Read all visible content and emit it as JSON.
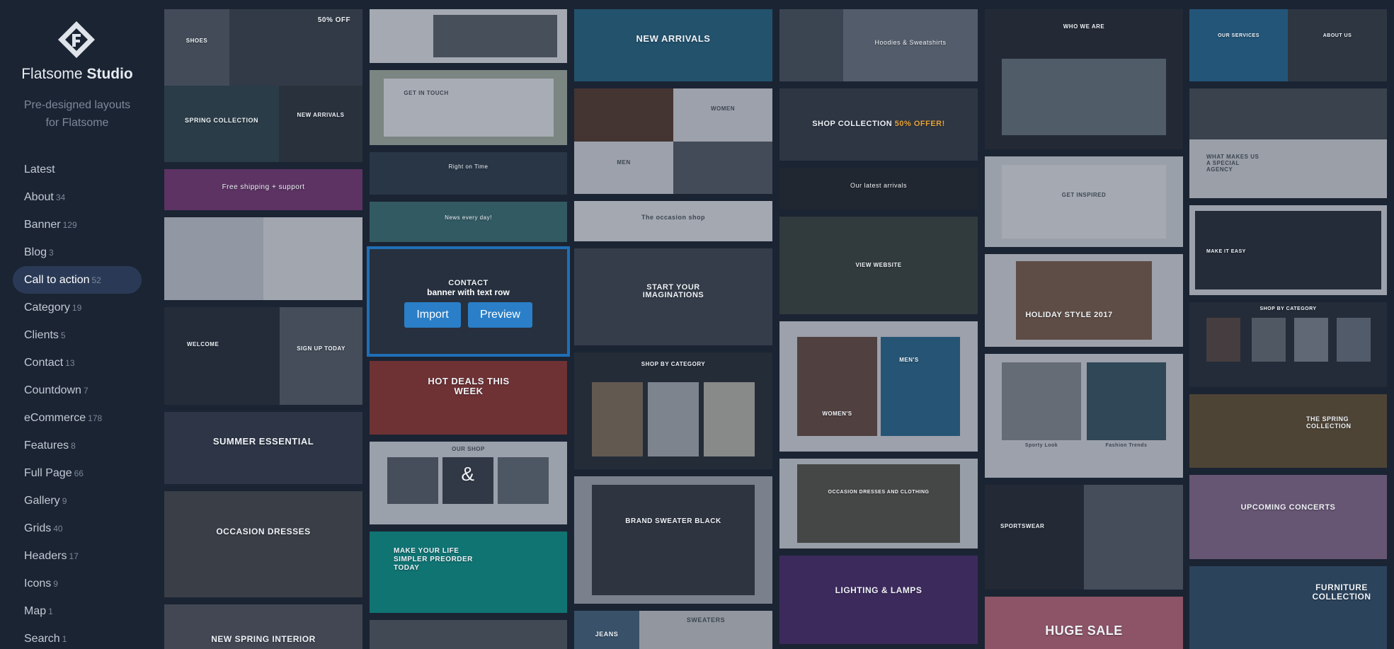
{
  "brand": {
    "name_regular": "Flatsome",
    "name_bold": "Studio",
    "tagline_line1": "Pre-designed layouts",
    "tagline_line2": "for Flatsome"
  },
  "nav": [
    {
      "label": "Latest",
      "count": ""
    },
    {
      "label": "About",
      "count": "34"
    },
    {
      "label": "Banner",
      "count": "129"
    },
    {
      "label": "Blog",
      "count": "3"
    },
    {
      "label": "Call to action",
      "count": "52"
    },
    {
      "label": "Category",
      "count": "19"
    },
    {
      "label": "Clients",
      "count": "5"
    },
    {
      "label": "Contact",
      "count": "13"
    },
    {
      "label": "Countdown",
      "count": "7"
    },
    {
      "label": "eCommerce",
      "count": "178"
    },
    {
      "label": "Features",
      "count": "8"
    },
    {
      "label": "Full Page",
      "count": "66"
    },
    {
      "label": "Gallery",
      "count": "9"
    },
    {
      "label": "Grids",
      "count": "40"
    },
    {
      "label": "Headers",
      "count": "17"
    },
    {
      "label": "Icons",
      "count": "9"
    },
    {
      "label": "Map",
      "count": "1"
    },
    {
      "label": "Search",
      "count": "1"
    }
  ],
  "selected": {
    "title": "CONTACT",
    "hover_label": "banner with text row",
    "import_label": "Import",
    "preview_label": "Preview"
  },
  "colors": {
    "sidebar_bg": "#1b2433",
    "active_item": "#2a3a56",
    "accent": "#2a7fc8",
    "selected_outline": "#1f6fb6"
  },
  "tiles": {
    "c1_shoes": "SHOES",
    "c1_off": "50% OFF",
    "c1_spring": "SPRING COLLECTION",
    "c1_new": "NEW ARRIVALS",
    "c1_shipping": "Free shipping + support",
    "c1_welcome": "WELCOME",
    "c1_signup": "SIGN UP TODAY",
    "c1_summer": "SUMMER ESSENTIAL",
    "c1_occasion": "OCCASION DRESSES",
    "c1_interior": "NEW SPRING INTERIOR",
    "c2_getintouch": "GET IN TOUCH",
    "c2_right": "Right on Time",
    "c2_news": "News every day!",
    "c2_hotdeals": "HOT DEALS THIS WEEK",
    "c2_ourshop": "OUR SHOP",
    "c2_amp": "&",
    "c2_life": "MAKE YOUR LIFE SIMPLER PREORDER TODAY",
    "c3_newarrivals": "NEW ARRIVALS",
    "c3_women": "WOMEN",
    "c3_men": "MEN",
    "c3_occasion": "The occasion shop",
    "c3_imag": "START YOUR IMAGINATIONS",
    "c3_shopcat": "SHOP BY CATEGORY",
    "c3_sweater": "BRAND SWEATER BLACK",
    "c3_sweaters": "SWEATERS",
    "c3_jeans": "JEANS",
    "c4_hoodies": "Hoodies & Sweatshirts",
    "c4_shopcoll": "SHOP COLLECTION",
    "c4_offer": "50% OFFER!",
    "c4_latest": "Our latest arrivals",
    "c4_website": "VIEW WEBSITE",
    "c4_womens": "WOMEN'S",
    "c4_mens": "MEN'S",
    "c4_occ": "OCCASION DRESSES AND CLOTHING",
    "c4_lighting": "LIGHTING & LAMPS",
    "c5_who": "WHO WE ARE",
    "c5_inspired": "GET INSPIRED",
    "c5_holiday": "HOLIDAY STYLE 2017",
    "c5_sporty": "Sporty Look",
    "c5_fashion": "Fashion Trends",
    "c5_sportswear": "SPORTSWEAR",
    "c5_huge": "HUGE SALE",
    "c6_services": "OUR SERVICES",
    "c6_about": "ABOUT US",
    "c6_what": "WHAT MAKES US A SPECIAL AGENCY",
    "c6_easy": "MAKE IT EASY",
    "c6_shopcat": "SHOP BY CATEGORY",
    "c6_spring": "THE SPRING COLLECTION",
    "c6_concerts": "UPCOMING CONCERTS",
    "c6_furniture": "FURNITURE COLLECTION"
  }
}
